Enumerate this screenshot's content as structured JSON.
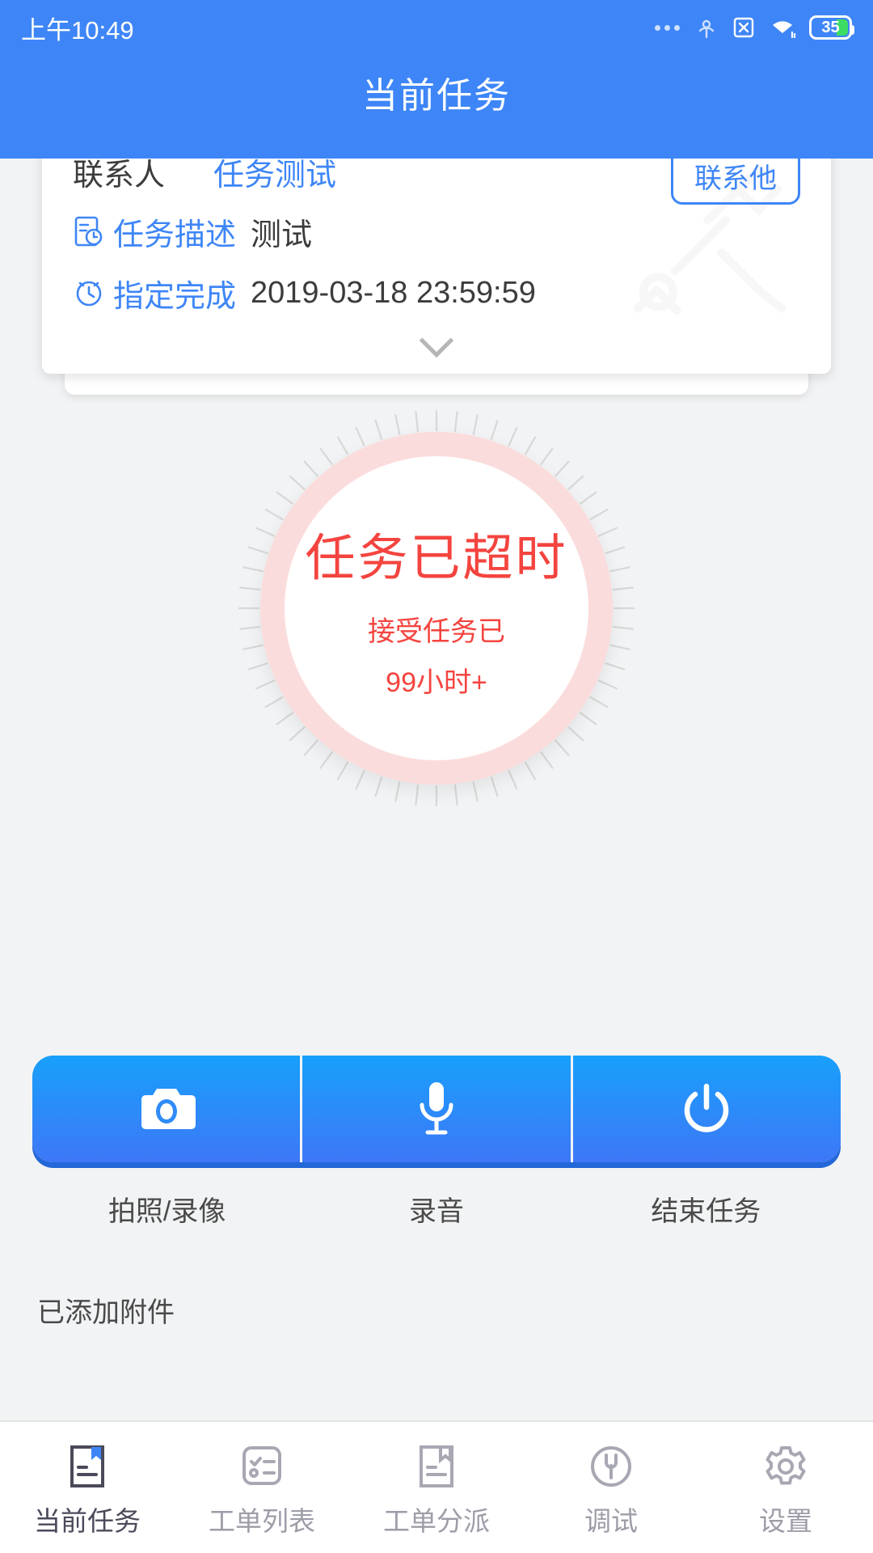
{
  "statusbar": {
    "time": "上午10:49",
    "battery_level": "35",
    "icons": [
      "more-dots-icon",
      "hotspot-icon",
      "sim-x-icon",
      "wifi-icon",
      "battery-icon"
    ]
  },
  "header": {
    "title": "当前任务"
  },
  "task_card": {
    "top_row": {
      "label": "联系人",
      "value": "任务测试",
      "button_label": "联系他"
    },
    "rows": [
      {
        "icon": "task-description-icon",
        "label": "任务描述",
        "value": "测试"
      },
      {
        "icon": "clock-icon",
        "label": "指定完成",
        "value": "2019-03-18 23:59:59"
      }
    ],
    "expand_icon": "chevron-down-icon"
  },
  "gauge": {
    "main_text": "任务已超时",
    "sub_text_1": "接受任务已",
    "sub_text_2": "99小时+",
    "accent_color": "#f4443f",
    "ring_color": "#fbdcdc",
    "tick_color": "#d6d6d6"
  },
  "actions": [
    {
      "icon": "camera-icon",
      "label": "拍照/录像"
    },
    {
      "icon": "microphone-icon",
      "label": "录音"
    },
    {
      "icon": "power-icon",
      "label": "结束任务"
    }
  ],
  "attachment": {
    "text": "已添加附件"
  },
  "tabs": [
    {
      "icon": "document-bookmark-icon",
      "label": "当前任务",
      "active": true
    },
    {
      "icon": "checklist-icon",
      "label": "工单列表",
      "active": false
    },
    {
      "icon": "document-assign-icon",
      "label": "工单分派",
      "active": false
    },
    {
      "icon": "wrench-circle-icon",
      "label": "调试",
      "active": false
    },
    {
      "icon": "gear-icon",
      "label": "设置",
      "active": false
    }
  ],
  "colors": {
    "brand_blue": "#3e86f7",
    "bg": "#f2f3f4",
    "tab_inactive": "#9d9da8",
    "tab_active": "#4a4a5a"
  }
}
